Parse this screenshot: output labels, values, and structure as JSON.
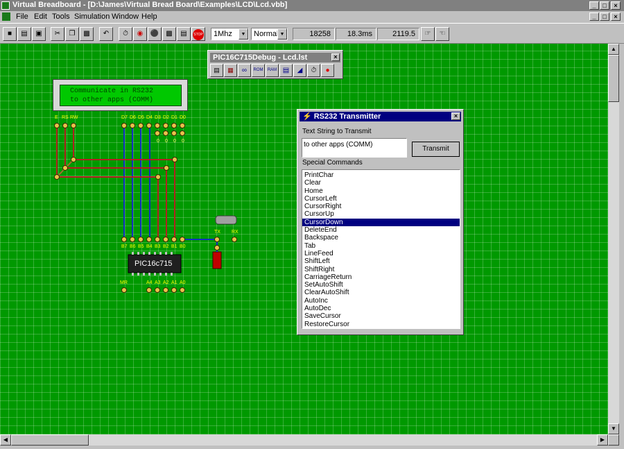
{
  "window": {
    "title": "Virtual Breadboard - [D:\\James\\Virtual Bread Board\\Examples\\LCD\\Lcd.vbb]",
    "caption_buttons": [
      "_",
      "□",
      "×"
    ]
  },
  "menu": [
    "File",
    "Edit",
    "Tools",
    "Simulation",
    "Window",
    "Help"
  ],
  "toolbar": {
    "clock_speed": "1Mhz",
    "mode": "Normal",
    "counter": "18258",
    "time": "18.3ms",
    "rate": "2119.5"
  },
  "lcd": {
    "line1": "Communicate in RS232",
    "line2": "to other apps (COMM)"
  },
  "lcd_pins": {
    "control": [
      "E",
      "RS",
      "RW"
    ],
    "data": [
      "D7",
      "D6",
      "D5",
      "D4",
      "D3",
      "D2",
      "D1",
      "D0"
    ],
    "data_values": [
      "0",
      "0",
      "0",
      "0"
    ]
  },
  "chip": {
    "label": "PIC16c715",
    "portb": [
      "B7",
      "B6",
      "B5",
      "B4",
      "B3",
      "B2",
      "B1",
      "B0"
    ],
    "porta": [
      "A4",
      "A3",
      "A2",
      "A1",
      "A0"
    ],
    "mr": "MR"
  },
  "serial": {
    "tx": "TX",
    "rx": "RX"
  },
  "debug_window": {
    "title": "PIC16C715Debug - Lcd.lst",
    "rom_label": "ROM",
    "ram_label": "RAM"
  },
  "rs232": {
    "title": "RS232 Transmitter",
    "text_label": "Text String to Transmit",
    "text_value": "to other apps (COMM)",
    "transmit_button": "Transmit",
    "commands_label": "Special Commands",
    "commands": [
      "PrintChar",
      "Clear",
      "Home",
      "CursorLeft",
      "CursorRight",
      "CursorUp",
      "CursorDown",
      "DeleteEnd",
      "Backspace",
      "Tab",
      "LineFeed",
      "ShiftLeft",
      "ShiftRight",
      "CarriageReturn",
      "SetAutoShift",
      "ClearAutoShift",
      "AutoInc",
      "AutoDec",
      "SaveCursor",
      "RestoreCursor"
    ],
    "selected": "CursorDown"
  }
}
